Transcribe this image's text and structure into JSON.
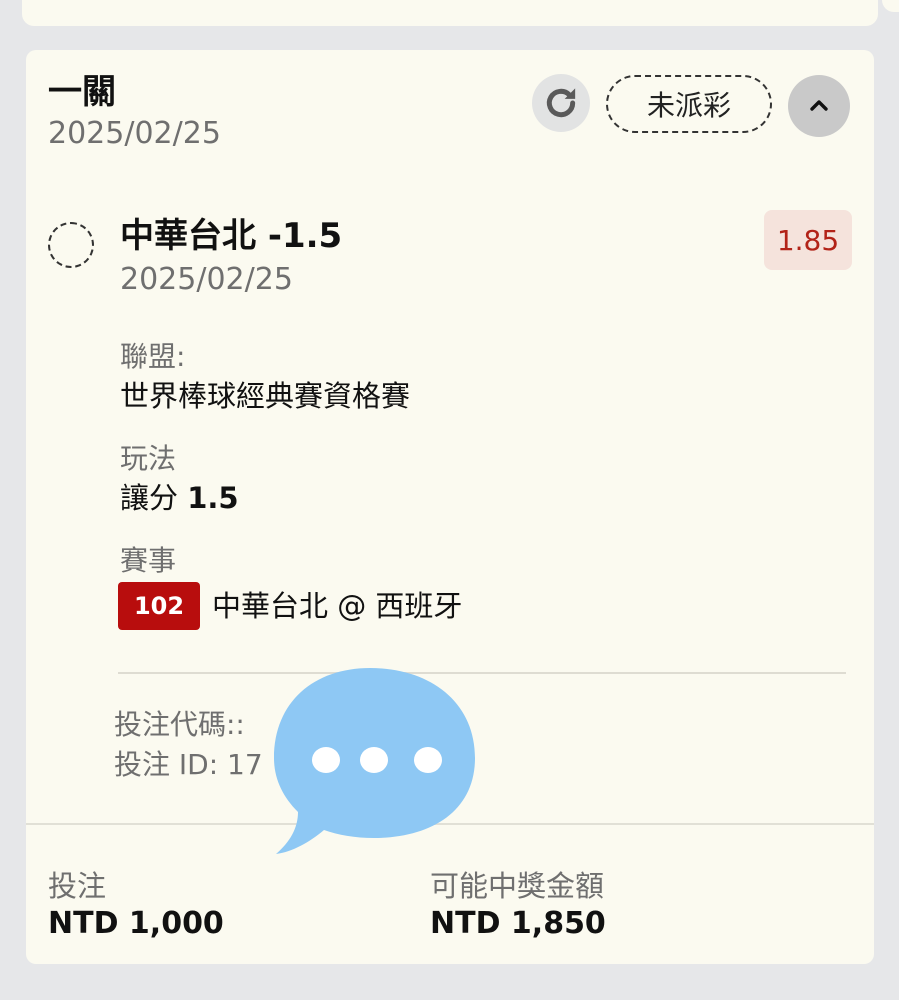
{
  "bet": {
    "type": "一關",
    "date": "2025/02/25",
    "status": "未派彩",
    "icons": {
      "refresh": "refresh-icon",
      "collapse": "chevron-up-icon"
    }
  },
  "selection": {
    "name": "中華台北 -1.5",
    "date": "2025/02/25",
    "odds": "1.85"
  },
  "details": {
    "league_label": "聯盟:",
    "league_value": "世界棒球經典賽資格賽",
    "market_label": "玩法",
    "market_value_prefix": "讓分",
    "market_value_number": "1.5",
    "event_label": "賽事",
    "event_number": "102",
    "event_name": "中華台北 @ 西班牙"
  },
  "meta": {
    "code_label": "投注代碼::",
    "id_label": "投注 ID: 17"
  },
  "footer": {
    "stake_label": "投注",
    "stake_value": "NTD 1,000",
    "payout_label": "可能中獎金額",
    "payout_value": "NTD 1,850"
  },
  "colors": {
    "card_bg": "#fbfaf0",
    "page_bg": "#e6e7e9",
    "event_badge": "#b80d0d",
    "odds_text": "#b22318",
    "odds_bg": "#f5e3dc",
    "chat_bubble": "#8ec8f4"
  }
}
